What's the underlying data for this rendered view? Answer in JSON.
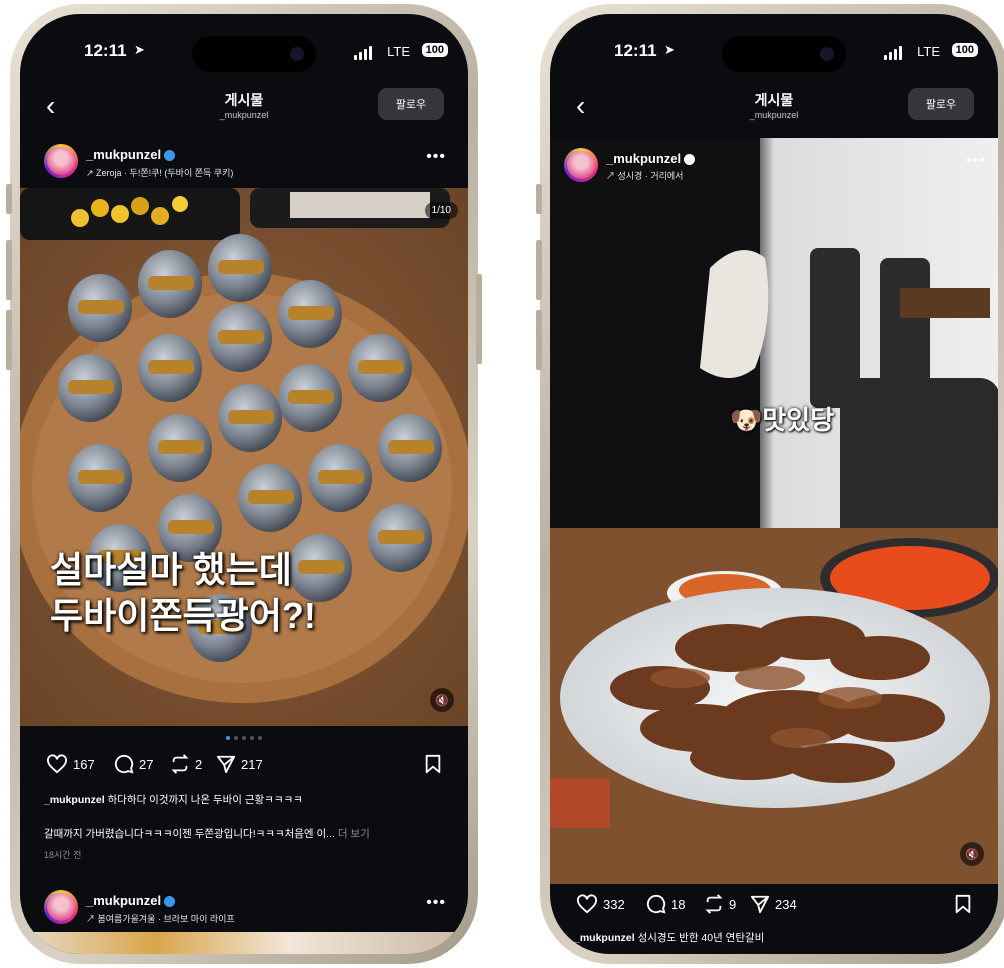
{
  "left": {
    "status": {
      "time": "12:11",
      "network": "LTE",
      "battery": "100"
    },
    "nav": {
      "title": "게시물",
      "subtitle": "_mukpunzel",
      "follow": "팔로우"
    },
    "post1": {
      "username": "_mukpunzel",
      "music": "↗ Zeroja · 두!쫀!쿠! (두바이 쫀득 쿠키)",
      "counter": "1/10",
      "overlay_line1": "설마설마 했는데",
      "overlay_line2": "두바이쫀득광어?!",
      "likes": "167",
      "comments": "27",
      "reposts": "2",
      "shares": "217",
      "caption_user": "_mukpunzel",
      "caption_text": "하다하다 이것까지 나온 두바이 근황ㅋㅋㅋㅋ",
      "caption_line2": "갈때까지 가버렸습니다ㅋㅋㅋ이젠 두쫀광입니다!ㅋㅋㅋ처음엔 이...",
      "more_label": "더 보기",
      "time_ago": "18시간 전"
    },
    "post2": {
      "username": "_mukpunzel",
      "music": "↗ 봄여름가을겨울 · 브라보 마이 라이프"
    }
  },
  "right": {
    "status": {
      "time": "12:11",
      "network": "LTE",
      "battery": "100"
    },
    "nav": {
      "title": "게시물",
      "subtitle": "_mukpunzel",
      "follow": "팔로우"
    },
    "post": {
      "username": "_mukpunzel",
      "location": "↗ 성시경 · 거리에서",
      "overlay": "맛있당",
      "likes": "332",
      "comments": "18",
      "reposts": "9",
      "shares": "234",
      "caption_user": "_mukpunzel",
      "caption_text": "성시경도 반한 40년 연탄갈비"
    }
  },
  "colors": {
    "background": "#0b0c10",
    "follow_button": "#35363a",
    "verified": "#3897f0",
    "muted_text": "#8e8e8e"
  }
}
